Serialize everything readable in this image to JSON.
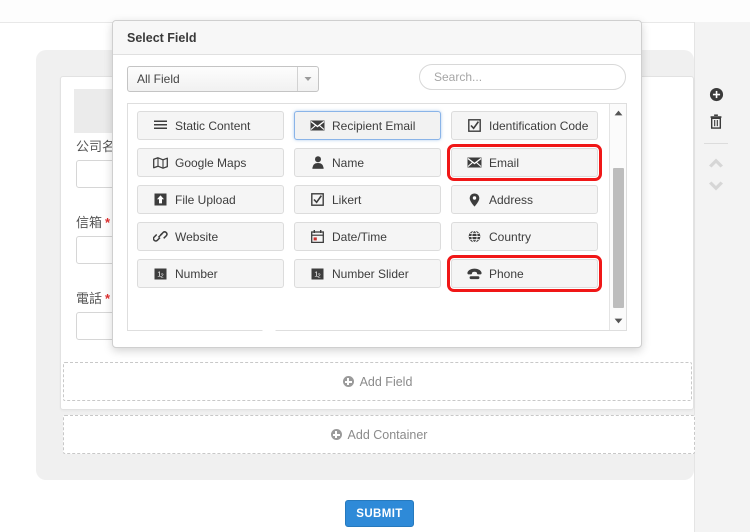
{
  "form": {
    "labels": [
      {
        "text": "公司名",
        "required": false
      },
      {
        "text": "信箱",
        "required": true
      },
      {
        "text": "電話",
        "required": true
      }
    ],
    "required_marker": "*",
    "add_field_label": "Add Field",
    "add_container_label": "Add Container",
    "submit_label": "SUBMIT"
  },
  "rail": {
    "tools": [
      {
        "name": "add-circle-icon",
        "title": "Add"
      },
      {
        "name": "trash-icon",
        "title": "Delete"
      }
    ],
    "chevrons": [
      {
        "name": "chevron-up-icon"
      },
      {
        "name": "chevron-down-icon"
      }
    ]
  },
  "popover": {
    "title": "Select Field",
    "filter": {
      "selected": "All Field",
      "options": [
        "All Field"
      ]
    },
    "search": {
      "value": "",
      "placeholder": "Search..."
    },
    "rows": [
      [
        {
          "label": "Static Content",
          "icon": "lines-icon",
          "state": "normal"
        },
        {
          "label": "Recipient Email",
          "icon": "envelope-icon",
          "state": "selected"
        },
        {
          "label": "Identification Code",
          "icon": "checked-box-icon",
          "state": "normal"
        }
      ],
      [
        {
          "label": "Google Maps",
          "icon": "map-icon",
          "state": "normal"
        },
        {
          "label": "Name",
          "icon": "person-icon",
          "state": "normal"
        },
        {
          "label": "Email",
          "icon": "envelope-icon",
          "state": "highlighted"
        }
      ],
      [
        {
          "label": "File Upload",
          "icon": "upload-icon",
          "state": "normal"
        },
        {
          "label": "Likert",
          "icon": "checked-box-icon",
          "state": "normal"
        },
        {
          "label": "Address",
          "icon": "map-pin-icon",
          "state": "normal"
        }
      ],
      [
        {
          "label": "Website",
          "icon": "link-icon",
          "state": "normal"
        },
        {
          "label": "Date/Time",
          "icon": "calendar-icon",
          "state": "normal"
        },
        {
          "label": "Country",
          "icon": "globe-icon",
          "state": "normal"
        }
      ],
      [
        {
          "label": "Number",
          "icon": "number-icon",
          "state": "normal"
        },
        {
          "label": "Number Slider",
          "icon": "number-icon",
          "state": "normal"
        },
        {
          "label": "Phone",
          "icon": "phone-icon",
          "state": "highlighted"
        }
      ]
    ]
  },
  "colors": {
    "submit_blue": "#2e8ad8",
    "highlight_red": "#f01717",
    "selected_blue": "#8ab4e8",
    "required_red": "#e03030"
  }
}
